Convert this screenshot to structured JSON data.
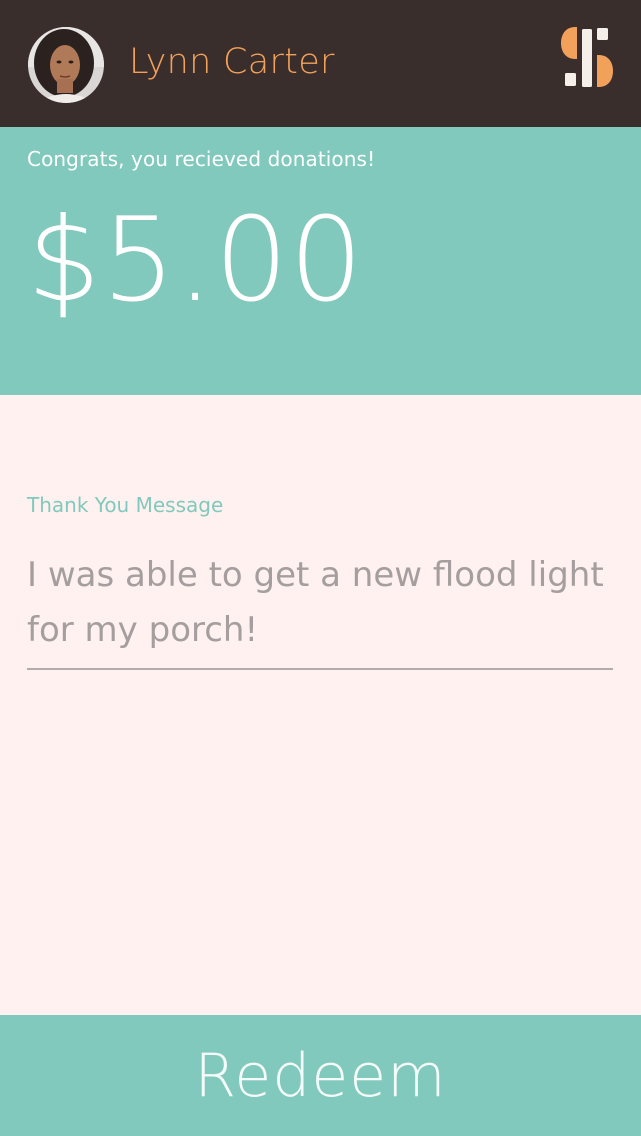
{
  "header": {
    "user_name": "Lynn Carter",
    "avatar_icon": "user-avatar",
    "logo_icon": "app-logo-icon"
  },
  "donation": {
    "congrats_text": "Congrats, you recieved donations!",
    "amount": "$5.00"
  },
  "message": {
    "label": "Thank You Message",
    "text": "I was able to get a new flood light for my porch!"
  },
  "actions": {
    "redeem_label": "Redeem"
  },
  "colors": {
    "header_bg": "#3a2e2d",
    "accent_orange": "#f2a15a",
    "teal": "#81c9bc",
    "page_bg": "#fef1ef",
    "message_text": "#a59e9e"
  }
}
